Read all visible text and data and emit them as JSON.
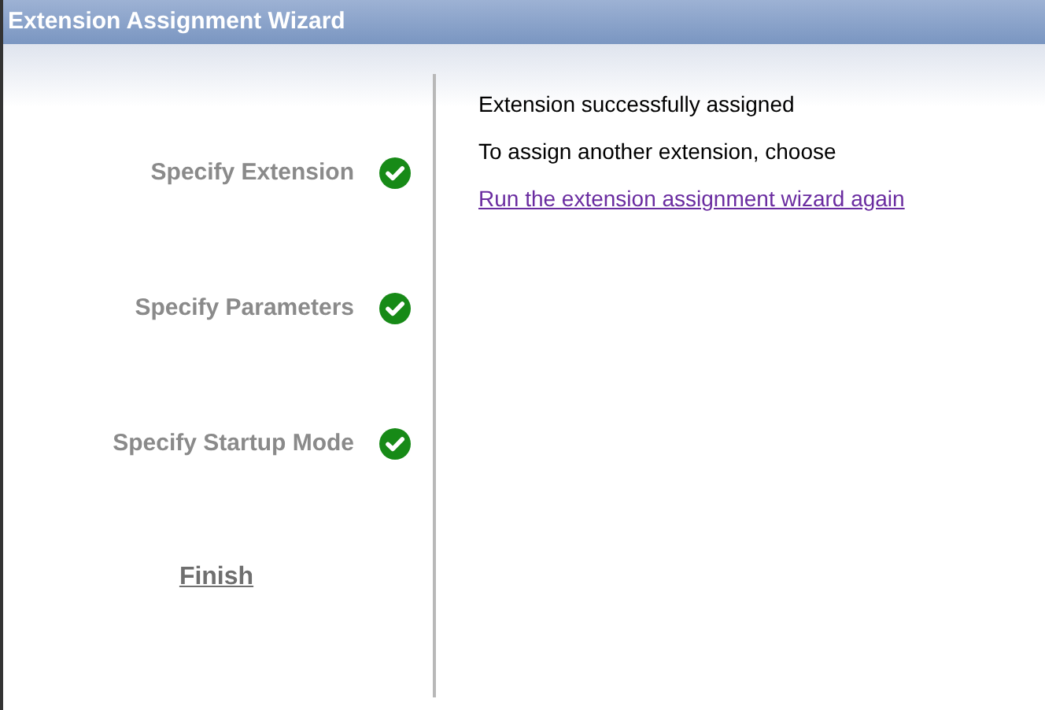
{
  "window": {
    "title": "Extension Assignment Wizard"
  },
  "steps": [
    {
      "label": "Specify Extension",
      "completed": true,
      "current": false
    },
    {
      "label": "Specify Parameters",
      "completed": true,
      "current": false
    },
    {
      "label": "Specify Startup Mode",
      "completed": true,
      "current": false
    },
    {
      "label": "Finish",
      "completed": false,
      "current": true
    }
  ],
  "content": {
    "message": "Extension successfully assigned",
    "instruction": "To assign another extension, choose",
    "link": "Run the extension assignment wizard again"
  }
}
